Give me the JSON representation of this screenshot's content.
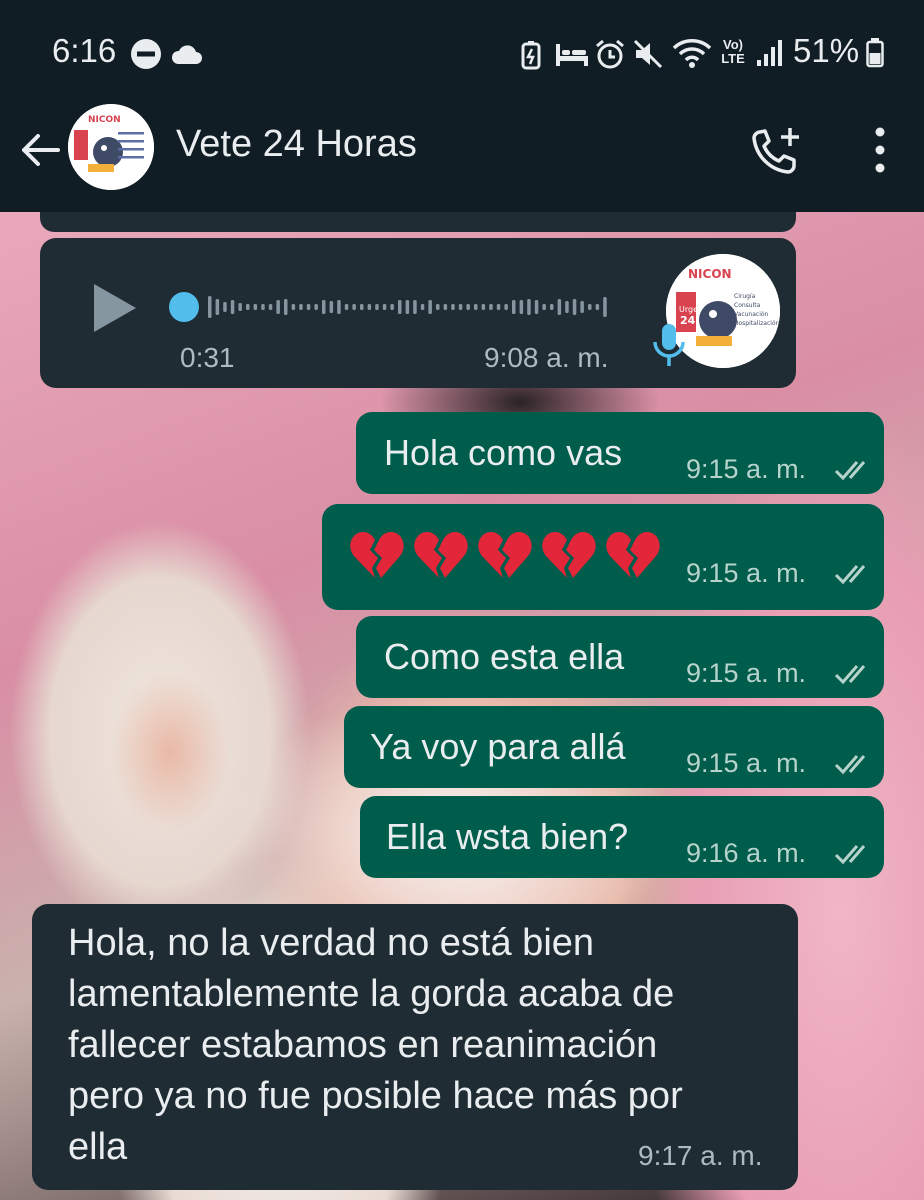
{
  "status_bar": {
    "time": "6:16",
    "battery_percent": "51%",
    "network_label": "Vo) LTE"
  },
  "header": {
    "contact_name": "Vete 24 Horas"
  },
  "voice_note": {
    "duration": "0:31",
    "time": "9:08 a. m.",
    "progress": 0
  },
  "messages_out": [
    {
      "text": "Hola como vas",
      "time": "9:15 a. m.",
      "status": "read"
    },
    {
      "text": "💔💔💔💔💔",
      "emoji_count": 5,
      "emoji": "broken-heart",
      "time": "9:15 a. m.",
      "status": "read"
    },
    {
      "text": "Como esta ella",
      "time": "9:15 a. m.",
      "status": "read"
    },
    {
      "text": "Ya voy para allá",
      "time": "9:15 a. m.",
      "status": "read"
    },
    {
      "text": "Ella wsta bien?",
      "time": "9:16 a. m.",
      "status": "read"
    }
  ],
  "message_in": {
    "lines": [
      "Hola, no la verdad no está bien",
      "lamentablemente la gorda acaba de",
      "fallecer estabamos en reanimación",
      "pero ya no fue posible hace más por",
      "ella"
    ],
    "time": "9:17 a. m."
  },
  "colors": {
    "header_bg": "#101d25",
    "incoming_bubble": "#1f2c34",
    "outgoing_bubble": "#005c4b",
    "read_ticks": "#b6d3cc",
    "mic_accent": "#53bdeb"
  },
  "icons": {
    "back": "arrow-left-icon",
    "add_call": "phone-plus-icon",
    "menu": "more-vertical-icon",
    "play": "play-icon",
    "mic": "microphone-icon",
    "ticks": "double-check-icon"
  }
}
